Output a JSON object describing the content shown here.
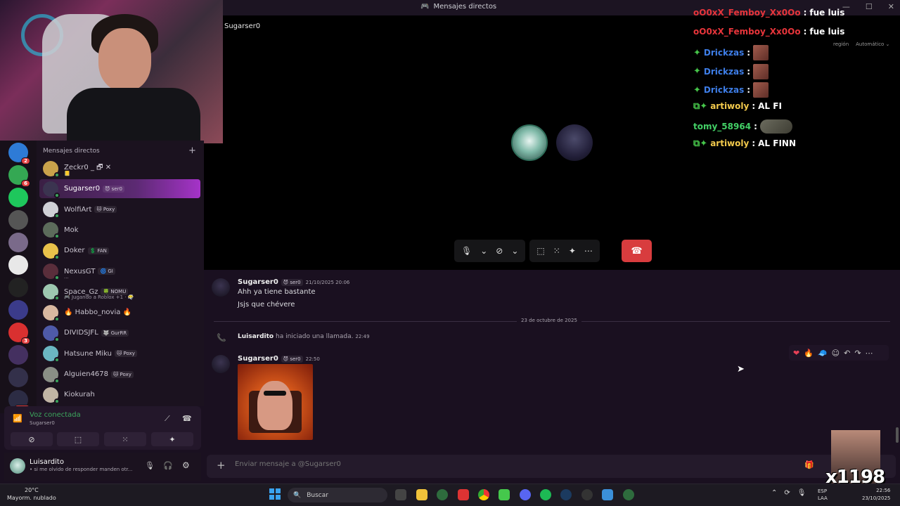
{
  "window": {
    "title": "Mensajes directos",
    "controls": [
      "—",
      "☐",
      "✕"
    ]
  },
  "servers": [
    {
      "badge": "2"
    },
    {
      "badge": "6"
    },
    {
      "badge": ""
    },
    {
      "badge": ""
    },
    {
      "badge": ""
    },
    {
      "badge": ""
    },
    {
      "badge": ""
    },
    {
      "badge": ""
    },
    {
      "badge": "3"
    },
    {
      "badge": ""
    },
    {
      "badge": ""
    },
    {
      "badge": "172"
    }
  ],
  "sidebar": {
    "header": "Mensajes directos",
    "add_icon": "+",
    "dms": [
      {
        "name": "Zeckr0 _ 🗗 ✕",
        "tag": "",
        "sub": "📒"
      },
      {
        "name": "Sugarser0",
        "tag": "😈 ser0",
        "sub": ""
      },
      {
        "name": "WolfiArt",
        "tag": "🐱 Poxy",
        "sub": ""
      },
      {
        "name": "Mok",
        "tag": "",
        "sub": ""
      },
      {
        "name": "Doker",
        "tag": "💲 FAN",
        "sub": ""
      },
      {
        "name": "NexusGT",
        "tag": "🌀 GI",
        "sub": "..."
      },
      {
        "name": "Space_Gz",
        "tag": "🍀 NOMU",
        "sub": "🎮 Jugando a Roblox +1 · 😶‍🌫️"
      },
      {
        "name": "🔥 Habbo_novia 🔥",
        "tag": "",
        "sub": ""
      },
      {
        "name": "DIVIDSJFL",
        "tag": "🐺 GurRR",
        "sub": ""
      },
      {
        "name": "Hatsune Miku",
        "tag": "🐱 Poxy",
        "sub": ""
      },
      {
        "name": "Alguien4678",
        "tag": "🐱 Poxy",
        "sub": ""
      },
      {
        "name": "Kiokurah",
        "tag": "",
        "sub": ""
      }
    ]
  },
  "voice": {
    "title": "Voz conectada",
    "channel": "Sugarser0"
  },
  "user": {
    "name": "Luisardito",
    "status": "• si me olvido de responder manden otr..."
  },
  "call": {
    "name": "Sugarser0",
    "controls": {
      "mic": "🎙",
      "chev1": "⌄",
      "cam": "⊘",
      "chev2": "⌄",
      "screen": "⬚",
      "activity": "⁙",
      "soundboard": "✦",
      "more": "⋯",
      "hangup": "☎"
    }
  },
  "stream_chat": [
    {
      "prefix": "",
      "user": "oO0xX_Femboy_Xx0Oo",
      "sep": " : ",
      "text": "fue luis",
      "color": "#e8353b"
    },
    {
      "prefix": "",
      "user": "oO0xX_Femboy_Xx0Oo",
      "sep": " : ",
      "text": "fue luis",
      "color": "#e8353b"
    },
    {
      "prefix": "✦",
      "user": "Drickzas",
      "sep": " :",
      "text": "",
      "color": "#3e7ee8",
      "emote": true
    },
    {
      "prefix": "✦",
      "user": "Drickzas",
      "sep": " :",
      "text": "",
      "color": "#3e7ee8",
      "emote": true
    },
    {
      "prefix": "✦",
      "user": "Drickzas",
      "sep": " :",
      "text": "",
      "color": "#3e7ee8",
      "emote": true
    },
    {
      "prefix": "⧉✦",
      "user": "artiwoly",
      "sep": " : ",
      "text": "AL FI",
      "color": "#f2c94c"
    },
    {
      "prefix": "",
      "user": "tomy_58964",
      "sep": " :",
      "text": "",
      "color": "#43d066",
      "emote2": true
    },
    {
      "prefix": "⧉✦",
      "user": "artiwoly",
      "sep": " : ",
      "text": "AL FINN",
      "color": "#f2c94c"
    }
  ],
  "overlay_right": {
    "region_label": "región",
    "region_value": "Automático ⌄"
  },
  "messages": {
    "m1": {
      "author": "Sugarser0",
      "tag": "😈 ser0",
      "time": "21/10/2025 20:06",
      "lines": [
        "Ahh ya tiene bastante",
        "Jsjs que chévere"
      ]
    },
    "date_divider": "23 de octubre de 2025",
    "call_event": {
      "author": "Luisardito",
      "text": "ha iniciado una llamada.",
      "time": "22:49"
    },
    "m2": {
      "author": "Sugarser0",
      "tag": "😈 ser0",
      "time": "22:50"
    },
    "tools": [
      "❤",
      "🔥",
      "🧢",
      "☺",
      "↶",
      "↷",
      "⋯"
    ]
  },
  "composer": {
    "placeholder": "Enviar mensaje a @Sugarser0",
    "plus": "+"
  },
  "facecam": {
    "overlay_text": "x1198"
  },
  "taskbar": {
    "weather_temp": "20°C",
    "weather_desc": "Mayorm. nublado",
    "search_placeholder": "Buscar",
    "lang_top": "ESP",
    "lang_bottom": "LAA",
    "time": "22:56",
    "date": "23/10/2025"
  }
}
